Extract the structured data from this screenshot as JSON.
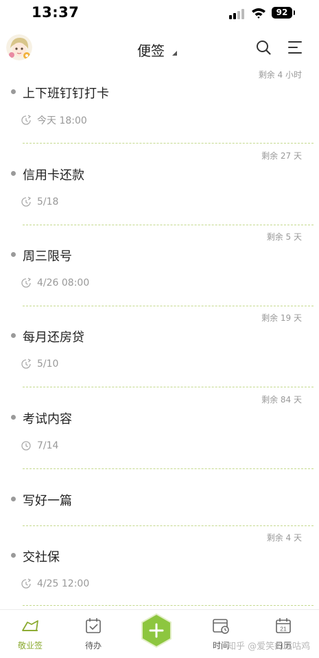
{
  "status_bar": {
    "time": "13:37",
    "battery": "92"
  },
  "header": {
    "title": "便签"
  },
  "notes": [
    {
      "remaining": "剩余 4 小时",
      "title": "上下班钉钉打卡",
      "date": "今天 18:00",
      "icon": "repeat-clock-icon"
    },
    {
      "remaining": "剩余 27 天",
      "title": "信用卡还款",
      "date": "5/18",
      "icon": "repeat-clock-icon"
    },
    {
      "remaining": "剩余 5 天",
      "title": "周三限号",
      "date": "4/26 08:00",
      "icon": "repeat-clock-icon"
    },
    {
      "remaining": "剩余 19 天",
      "title": "每月还房贷",
      "date": "5/10",
      "icon": "repeat-clock-icon"
    },
    {
      "remaining": "剩余 84 天",
      "title": "考试内容",
      "date": "7/14",
      "icon": "clock-icon"
    },
    {
      "remaining": "",
      "title": "写好一篇",
      "date": "",
      "icon": ""
    },
    {
      "remaining": "剩余 4 天",
      "title": "交社保",
      "date": "4/25 12:00",
      "icon": "repeat-clock-icon"
    }
  ],
  "bottom_nav": {
    "items": [
      {
        "label": "敬业签",
        "icon": "memo-icon",
        "active": true
      },
      {
        "label": "待办",
        "icon": "todo-check-icon",
        "active": false
      },
      {
        "label": "时间",
        "icon": "time-icon",
        "active": false
      },
      {
        "label": "日历",
        "icon": "calendar-icon",
        "calendar_day": "21",
        "active": false
      }
    ]
  },
  "watermark": "知乎 @爱笑的咕咕鸡",
  "colors": {
    "accent": "#8dc63f",
    "divider": "#c4d98c",
    "muted_text": "#999999"
  }
}
